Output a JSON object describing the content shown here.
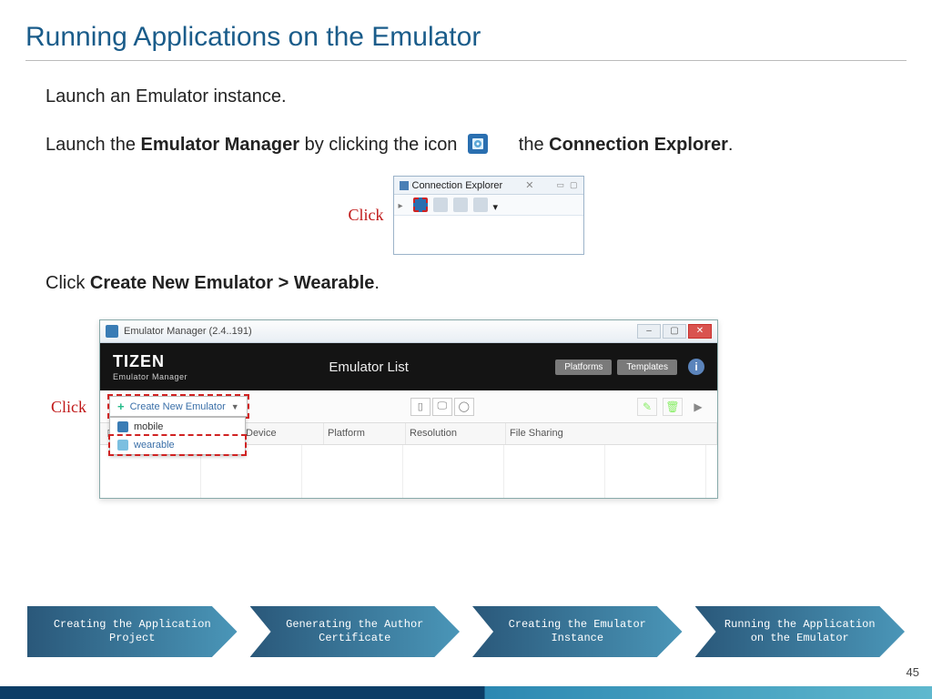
{
  "title": "Running Applications on the Emulator",
  "p1": "Launch an Emulator instance.",
  "p2a": "Launch the ",
  "p2b": "Emulator Manager",
  "p2c": " by clicking the icon ",
  "p2d": "the ",
  "p2e": "Connection Explorer",
  "p2f": ".",
  "click_label": "Click",
  "conn": {
    "tab": "Connection Explorer"
  },
  "p3a": "Click ",
  "p3b": "Create New Emulator > Wearable",
  "p3c": ".",
  "em": {
    "wintitle": "Emulator Manager (2.4..191)",
    "logo": "TIZEN",
    "logosub": "Emulator Manager",
    "list_title": "Emulator List",
    "pill_platforms": "Platforms",
    "pill_templates": "Templates",
    "btn_new": "Create New Emulator",
    "dd_mobile": "mobile",
    "dd_wearable": "wearable",
    "cols": {
      "name": "ne",
      "device": "Device",
      "platform": "Platform",
      "resolution": "Resolution",
      "fileshare": "File Sharing"
    }
  },
  "steps": [
    "Creating the Application Project",
    "Generating the Author Certificate",
    "Creating the Emulator Instance",
    "Running the Application on the Emulator"
  ],
  "page": "45"
}
